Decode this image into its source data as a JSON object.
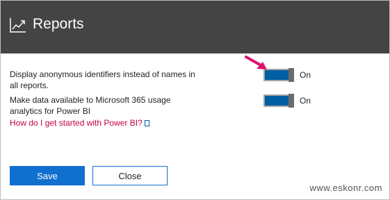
{
  "header": {
    "title": "Reports",
    "icon": "trend-chart-icon",
    "background": "#444444"
  },
  "settings": [
    {
      "label_line1": "Display anonymous identifiers instead of names in",
      "label_line2": "all reports.",
      "toggle_state": "On",
      "enabled": true
    },
    {
      "label_line1": "Make data available to Microsoft 365 usage",
      "label_line2": "analytics for Power BI",
      "toggle_state": "On",
      "enabled": true
    }
  ],
  "help_link": {
    "text": "How do I get started with Power BI?",
    "icon": "external-link-icon"
  },
  "buttons": {
    "save": "Save",
    "close": "Close"
  },
  "annotation": {
    "icon": "pointer-arrow-icon",
    "color": "#e0126e"
  },
  "watermark": "www.eskonr.com",
  "colors": {
    "accent": "#1170cf",
    "toggle_on": "#005ea2",
    "link": "#c5003e"
  }
}
